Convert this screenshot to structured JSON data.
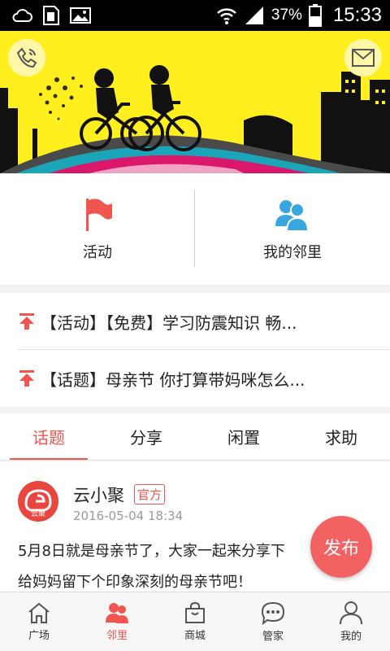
{
  "status_bar": {
    "battery_percent": "37%",
    "time": "15:33",
    "icons": [
      "cloud-icon",
      "sim-icon",
      "image-icon",
      "wifi-icon",
      "signal-icon",
      "battery-icon"
    ]
  },
  "banner": {
    "left_button_icon": "phone-icon",
    "right_button_icon": "mail-icon",
    "colors": {
      "background": "#ffef1f",
      "ground_magenta": "#d9176b",
      "ground_teal": "#1aa5b8"
    }
  },
  "quick_entries": [
    {
      "label": "活动",
      "icon": "flag-icon"
    },
    {
      "label": "我的邻里",
      "icon": "neighbors-icon"
    }
  ],
  "news": [
    {
      "text": "【活动】【免费】学习防震知识 畅...",
      "icon": "top-arrow-icon"
    },
    {
      "text": "【话题】母亲节 你打算带妈咪怎么...",
      "icon": "top-arrow-icon"
    }
  ],
  "tabs": [
    "话题",
    "分享",
    "闲置",
    "求助"
  ],
  "active_tab": "话题",
  "post": {
    "author": "云小聚",
    "badge": "官方",
    "time": "2016-05-04 18:34",
    "avatar_text": "云聚",
    "lines": [
      "5月8日就是母亲节了，大家一起来分享下",
      "给妈妈留下个印象深刻的母亲节吧！"
    ]
  },
  "fab_label": "发布",
  "bottom_nav": [
    {
      "label": "广场",
      "icon": "home-icon"
    },
    {
      "label": "邻里",
      "icon": "people-icon"
    },
    {
      "label": "商城",
      "icon": "bag-icon"
    },
    {
      "label": "管家",
      "icon": "chat-icon"
    },
    {
      "label": "我的",
      "icon": "user-icon"
    }
  ],
  "active_nav": "邻里",
  "accent_color": "#f0554f"
}
